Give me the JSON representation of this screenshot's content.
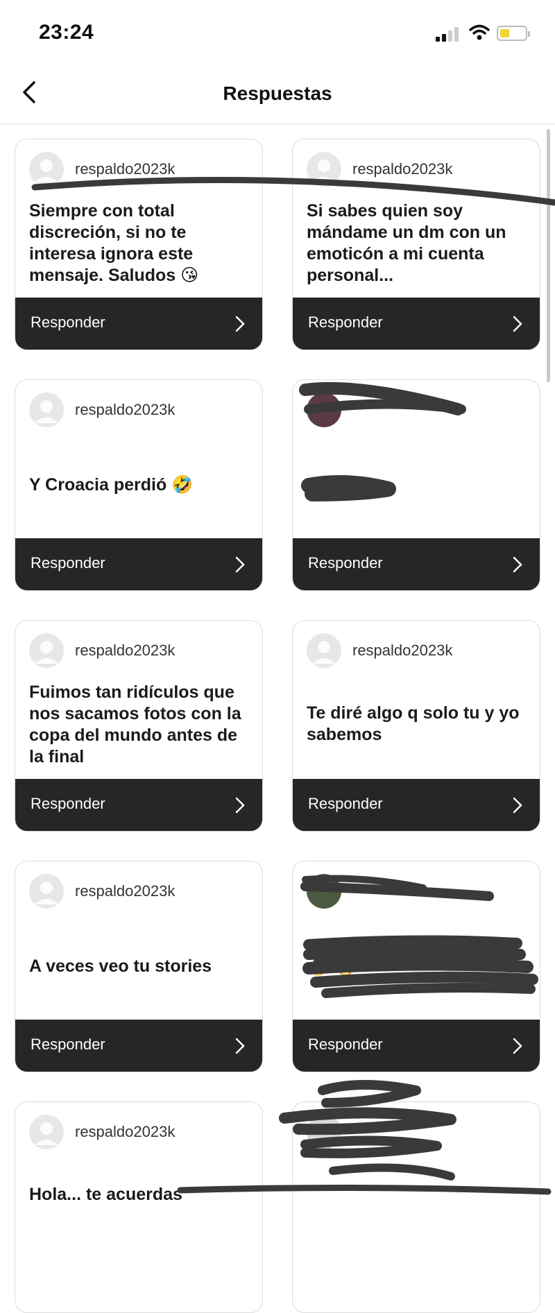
{
  "status_bar": {
    "time": "23:24"
  },
  "header": {
    "title": "Respuestas"
  },
  "cards": [
    {
      "username": "respaldo2023k",
      "message": "Siempre con total discreción, si no te interesa ignora este mensaje. Saludos 😘",
      "reply_label": "Responder"
    },
    {
      "username": "respaldo2023k",
      "message": "Si sabes quien soy mándame un dm con un emoticón a mi cuenta personal...",
      "reply_label": "Responder"
    },
    {
      "username": "respaldo2023k",
      "message": "Y Croacia perdió 🤣",
      "reply_label": "Responder"
    },
    {
      "username": "",
      "message": "",
      "reply_label": "Responder"
    },
    {
      "username": "respaldo2023k",
      "message": "Fuimos tan ridículos que nos sacamos fotos con la copa del mundo antes de la final",
      "reply_label": "Responder"
    },
    {
      "username": "respaldo2023k",
      "message": "Te diré algo q solo tu y yo sabemos",
      "reply_label": "Responder"
    },
    {
      "username": "respaldo2023k",
      "message": "A veces veo tu stories",
      "reply_label": "Responder"
    },
    {
      "username": "",
      "message": "🔥 🔥",
      "reply_label": "Responder"
    },
    {
      "username": "respaldo2023k",
      "message": "Hola... te acuerdas",
      "reply_label": ""
    },
    {
      "username": "",
      "message": "",
      "reply_label": ""
    }
  ],
  "colors": {
    "reply_bar": "#262626",
    "battery": "#f4d33a",
    "redaction": "#3a3a3a"
  },
  "icons": {
    "back": "chevron-left-icon",
    "reply": "chevron-right-icon",
    "signal": "signal-icon",
    "wifi": "wifi-icon",
    "battery": "battery-icon"
  }
}
